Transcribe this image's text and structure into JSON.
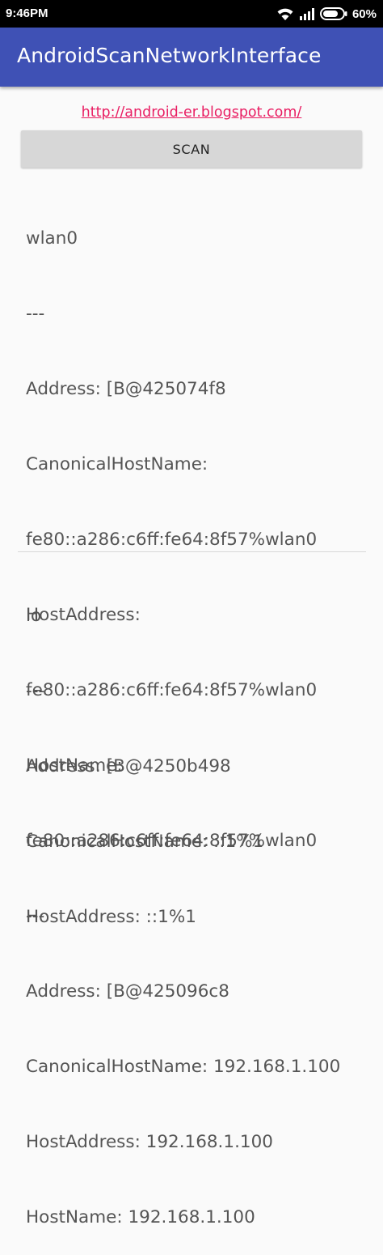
{
  "status_bar": {
    "time": "9:46PM",
    "battery_percent": "60%",
    "icons": [
      "wifi-icon",
      "signal-icon",
      "battery-icon"
    ]
  },
  "app_bar": {
    "title": "AndroidScanNetworkInterface",
    "color": "#3f51b5"
  },
  "link": {
    "text": "http://android-er.blogspot.com/",
    "color": "#e91e63"
  },
  "scan_button": {
    "label": "SCAN"
  },
  "interfaces": [
    {
      "lines": [
        "wlan0",
        "---",
        "Address: [B@425074f8",
        "CanonicalHostName:",
        "fe80::a286:c6ff:fe64:8f57%wlan0",
        "HostAddress:",
        "fe80::a286:c6ff:fe64:8f57%wlan0",
        "HostName:",
        "fe80::a286:c6ff:fe64:8f57%wlan0",
        "---",
        "Address: [B@425096c8",
        "CanonicalHostName: 192.168.1.100",
        "HostAddress: 192.168.1.100",
        "HostName: 192.168.1.100"
      ]
    },
    {
      "lines": [
        "lo",
        "---",
        "Address: [B@4250b498",
        "CanonicalHostName: ::1%1",
        "HostAddress: ::1%1"
      ]
    }
  ]
}
